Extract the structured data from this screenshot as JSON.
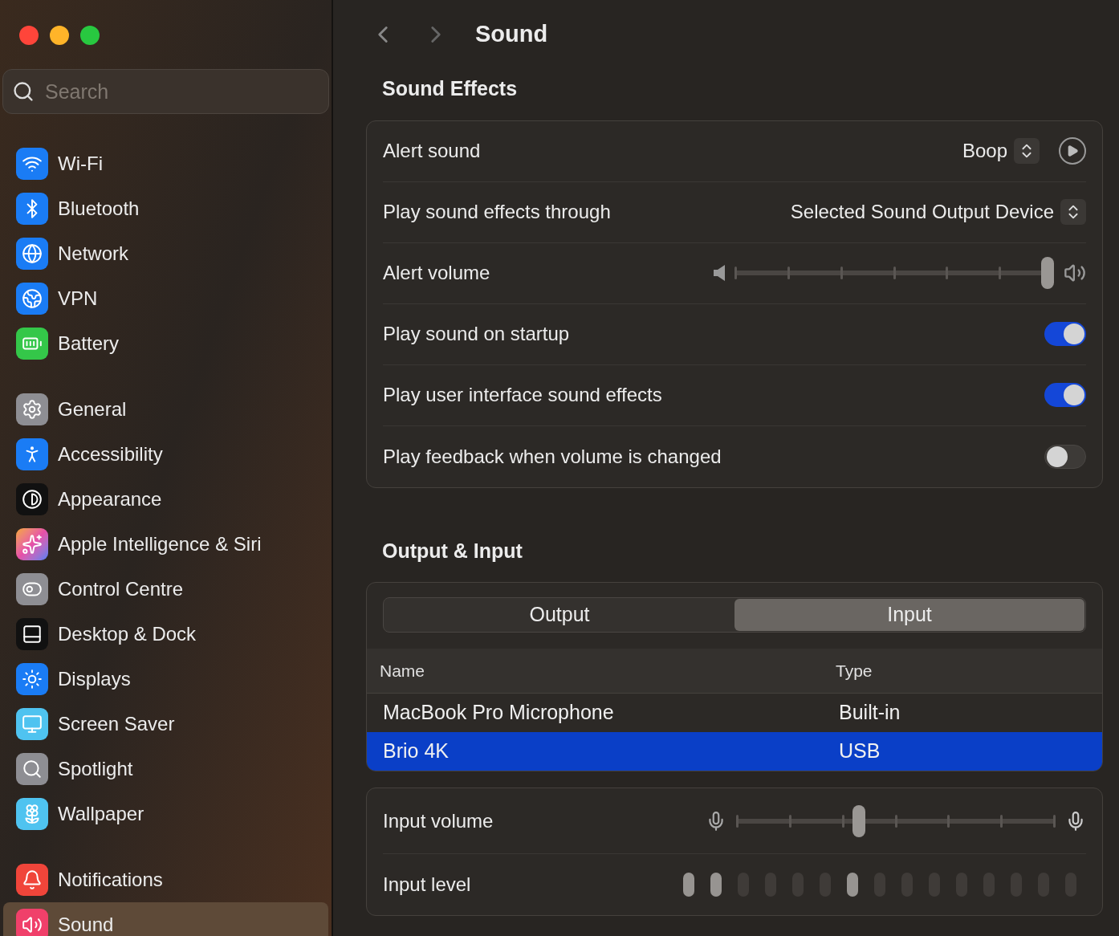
{
  "window": {
    "title": "Sound",
    "traffic_lights": [
      {
        "color": "#ff453a"
      },
      {
        "color": "#ffb429"
      },
      {
        "color": "#28c840"
      }
    ]
  },
  "sidebar": {
    "search": {
      "placeholder": "Search"
    },
    "groups": [
      [
        {
          "label": "Wi-Fi",
          "kind": "wifi",
          "selected": false
        },
        {
          "label": "Bluetooth",
          "kind": "bluetooth",
          "selected": false
        },
        {
          "label": "Network",
          "kind": "network",
          "selected": false
        },
        {
          "label": "VPN",
          "kind": "vpn",
          "selected": false
        },
        {
          "label": "Battery",
          "kind": "battery",
          "selected": false
        }
      ],
      [
        {
          "label": "General",
          "kind": "general",
          "selected": false
        },
        {
          "label": "Accessibility",
          "kind": "accessibility",
          "selected": false
        },
        {
          "label": "Appearance",
          "kind": "appearance",
          "selected": false
        },
        {
          "label": "Apple Intelligence & Siri",
          "kind": "siri",
          "selected": false
        },
        {
          "label": "Control Centre",
          "kind": "control",
          "selected": false
        },
        {
          "label": "Desktop & Dock",
          "kind": "desktop",
          "selected": false
        },
        {
          "label": "Displays",
          "kind": "displays",
          "selected": false
        },
        {
          "label": "Screen Saver",
          "kind": "screensaver",
          "selected": false
        },
        {
          "label": "Spotlight",
          "kind": "spotlight",
          "selected": false
        },
        {
          "label": "Wallpaper",
          "kind": "wallpaper",
          "selected": false
        }
      ],
      [
        {
          "label": "Notifications",
          "kind": "notifications",
          "selected": false
        },
        {
          "label": "Sound",
          "kind": "sound",
          "selected": true
        }
      ]
    ]
  },
  "sound_effects": {
    "heading": "Sound Effects",
    "rows": [
      {
        "kind": "popup",
        "label": "Alert sound",
        "value": "Boop",
        "play": true
      },
      {
        "kind": "popup",
        "label": "Play sound effects through",
        "value": "Selected Sound Output Device",
        "play": false
      },
      {
        "kind": "slider",
        "label": "Alert volume",
        "level": 1.0
      },
      {
        "kind": "toggle",
        "label": "Play sound on startup",
        "on": true
      },
      {
        "kind": "toggle",
        "label": "Play user interface sound effects",
        "on": true
      },
      {
        "kind": "toggle",
        "label": "Play feedback when volume is changed",
        "on": false
      }
    ]
  },
  "output_input": {
    "heading": "Output & Input",
    "tabs": [
      {
        "label": "Output",
        "selected": false
      },
      {
        "label": "Input",
        "selected": true
      }
    ],
    "table": {
      "columns": [
        "Name",
        "Type"
      ],
      "rows": [
        {
          "name": "MacBook Pro Microphone",
          "type": "Built-in",
          "selected": false
        },
        {
          "name": "Brio 4K",
          "type": "USB",
          "selected": true
        }
      ]
    },
    "input_volume": {
      "label": "Input volume",
      "level": 0.38
    },
    "input_level": {
      "label": "Input level",
      "segments": [
        {
          "lit": true
        },
        {
          "lit": true
        },
        {
          "lit": false
        },
        {
          "lit": false
        },
        {
          "lit": false
        },
        {
          "lit": false
        },
        {
          "lit": true
        },
        {
          "lit": false
        },
        {
          "lit": false
        },
        {
          "lit": false
        },
        {
          "lit": false
        },
        {
          "lit": false
        },
        {
          "lit": false
        },
        {
          "lit": false
        },
        {
          "lit": false
        }
      ]
    }
  }
}
